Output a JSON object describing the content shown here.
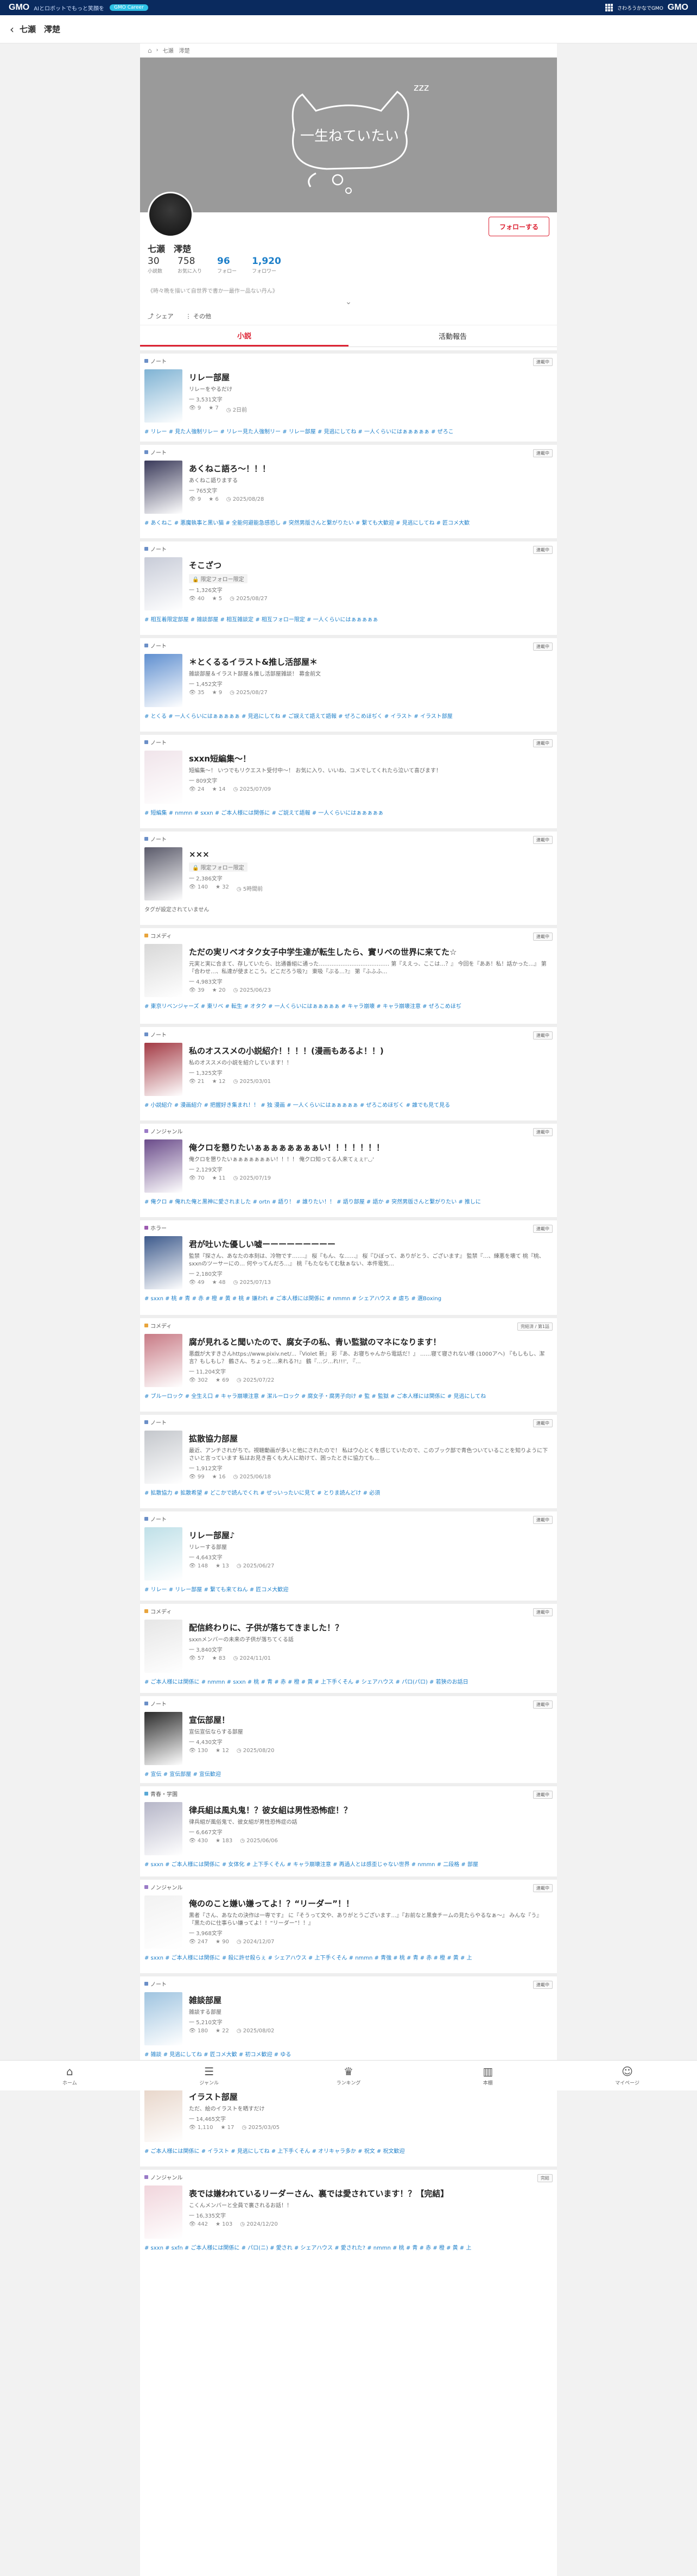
{
  "gmo": {
    "logo": "GMO",
    "tagline": "AIとロボットでもっと笑顔を",
    "badge": "GMO Career",
    "right_text": "さわろうかなでGMO",
    "right_logo": "GMO"
  },
  "header": {
    "title": "七瀬　澪楚"
  },
  "breadcrumb": [
    "七瀬　澪楚"
  ],
  "cover": {
    "text": "一生ねていたい",
    "zzz": "zzz"
  },
  "profile": {
    "name": "七瀬　澪楚",
    "follow_label": "フォローする",
    "stats": [
      {
        "value": "30",
        "label": "小説数"
      },
      {
        "value": "758",
        "label": "お気に入り"
      },
      {
        "value": "96",
        "label": "フォロー"
      },
      {
        "value": "1,920",
        "label": "フォロワー"
      }
    ],
    "bio": "《時々晩を描いて自世界で書か一最作ー品ない丹ん》",
    "share_label": "シェア",
    "more_label": "その他"
  },
  "tabs": [
    {
      "label": "小説"
    },
    {
      "label": "活動報告"
    }
  ],
  "colors": {
    "accent": "#dd2233",
    "link": "#1d7fc9",
    "gmo_navy": "#0a2a5e"
  },
  "novels": [
    {
      "category": "ノート",
      "cat_color": "#6b8fc7",
      "badge": "連載中",
      "title": "リレー部屋",
      "summary": "リレーをやるだけ",
      "chars": "一 3,531文字",
      "stats": [
        "9",
        "7",
        "2日前"
      ],
      "tags": "# リレー  # 見た人強制リレー  # リレー見た人強制リー  # リレー部屋  # 見逃にしてね  # 一人くらいにはぁぁぁぁぁ  # ぜろこ",
      "thumb_color": "#7fb3d4"
    },
    {
      "category": "ノート",
      "cat_color": "#6b8fc7",
      "badge": "連載中",
      "title": "あくねこ語ろ～！！！",
      "summary": "あくねこ語りまする",
      "chars": "一 765文字",
      "stats": [
        "9",
        "6",
        "2025/08/28"
      ],
      "tags": "# あくねこ  # 悪魔執事と黒い猫  # 全能何避能急感恐し  # 突然男版さんと繋がりたい  # 繋ても大歓迎  # 見逃にしてね  # 匠コメ大歓",
      "thumb_color": "#3a3a5a"
    },
    {
      "category": "ノート",
      "cat_color": "#6b8fc7",
      "badge": "連載中",
      "title": "そこざつ",
      "locked": "限定フォロー限定",
      "chars": "一 1,326文字",
      "stats": [
        "40",
        "5",
        "2025/08/27"
      ],
      "tags": "# 相互着限定部屋  # 雑談部屋  # 相互雑談定  # 相互フォロー限定  # 一人くらいにはぁぁぁぁぁ",
      "thumb_color": "#c8ccd8"
    },
    {
      "category": "ノート",
      "cat_color": "#6b8fc7",
      "badge": "連載中",
      "title": "＊とくるるイラスト&推し活部屋＊",
      "summary": "雑談部屋＆イラスト部屋＆推し活部屋雑談！ 募金前文",
      "chars": "一 1,452文字",
      "stats": [
        "35",
        "9",
        "2025/08/27"
      ],
      "tags": "# とくる  # 一人くらいにはぁぁぁぁぁ  # 見逃にしてね  # ご誤えて語えて語報  # ぜろこめほぢく  # イラスト  # イラスト部屋",
      "thumb_color": "#5f8fd0"
    },
    {
      "category": "ノート",
      "cat_color": "#6b8fc7",
      "badge": "連載中",
      "title": "sxxn短編集～！",
      "summary": "短編集～！ いつでもリクエスト受付中～！ お気に入り、いいね、コメでしてくれたら泣いて喜びます！",
      "chars": "一 809文字",
      "stats": [
        "24",
        "14",
        "2025/07/09"
      ],
      "tags": "# 短編集  # nmmn  # sxxn  # ご本人様には関係に  # ご説えて語報  # 一人くらいにはぁぁぁぁぁ",
      "thumb_color": "#f0e4ea"
    },
    {
      "category": "ノート",
      "cat_color": "#6b8fc7",
      "badge": "連載中",
      "title": "×××",
      "locked": "限定フォロー限定",
      "chars": "一 2,386文字",
      "stats": [
        "140",
        "32",
        "5時間前"
      ],
      "notags": "タグが設定されていません",
      "thumb_color": "#5a5a6a"
    },
    {
      "category": "コメディ",
      "cat_color": "#e8a43c",
      "badge": "連載中",
      "title": "ただの実リベオタク女子中学生達が転生したら、實リベの世界に来てた☆",
      "summary": "元実と実に合まて、存していたら、比通番組に通った………………………………… 第『ええっ、ここは…？』 今回を『ああ！私！話かった…』 第『合わせ…、私達が使まとこう。どこだろう吸?』 東吸『ぶる…?』 第『ふふふ…",
      "chars": "一 4,983文字",
      "stats": [
        "39",
        "20",
        "2025/06/23"
      ],
      "tags": "# 東京リベンジャーズ  # 東リベ  # 転生  # オタク  # 一人くらいにはぁぁぁぁぁ  # キャラ崩壊  # キャラ崩壊注意  # ぜろこめほぢ",
      "thumb_color": "#d8d8d8"
    },
    {
      "category": "ノート",
      "cat_color": "#6b8fc7",
      "badge": "連載中",
      "title": "私のオススメの小説紹介！！！！(漫画もあるよ！！)",
      "summary": "私のオススメの小説を紹介しています！！",
      "chars": "一 1,325文字",
      "stats": [
        "21",
        "12",
        "2025/03/01"
      ],
      "tags": "# 小説紹介  # 漫画紹介  # 把握好き集まれ！！  # 独 漫画  # 一人くらいにはぁぁぁぁぁ  # ぜろこめほぢく  # 誰でも見て見る",
      "thumb_color": "#a33a44"
    },
    {
      "category": "ノンジャンル",
      "cat_color": "#9a7bc7",
      "badge": "連載中",
      "title": "俺クロを懇りたいぁぁぁぁぁぁぁぁい！！！！！！！",
      "summary": "俺クロを懇りたいぁぁぁぁぁぁぁい！！！！ 俺クロ知ってる人来てぇぇ!'◡'",
      "chars": "一 2,129文字",
      "stats": [
        "70",
        "11",
        "2025/07/19"
      ],
      "tags": "# 俺クロ  # 俺れた俺と黒神に愛されました  # ortn  # 語り！  # 誰りたい！！  # 語り部屋  # 語か  # 突然男版さんと繋がりたい  # 推しに",
      "thumb_color": "#6a4b8a"
    },
    {
      "category": "ホラー",
      "cat_color": "#9c5ab0",
      "badge": "連載中",
      "title": "君が吐いた優しい嘘ーーーーーーーーー",
      "summary": "監禁『探さん、あなたの本刻は、冷物です…….』 桜『もん、な……』 桜『ひぼって、ありがとう、ございます』 監禁『…、練悪を壊て 桃『桃、sxxnのツーサーにの… 何やってんだろ…』 桃『もたなもてむ駄ぁない、本件電気…",
      "chars": "一 2,180文字",
      "stats": [
        "49",
        "48",
        "2025/07/13"
      ],
      "tags": "# sxxn  # 桃  # 青  # 赤  # 橙  # 黄  # 桃  # 嫌われ  # ご本人様には関係に  # nmmn  # シェアハウス  # 虐ち  # 選Boxing",
      "thumb_color": "#3d5a8c"
    },
    {
      "category": "コメディ",
      "cat_color": "#e8a43c",
      "badge": "完結済 / 第1話",
      "title": "腐が見れると聞いたので、腐女子の私、青い監獄のマネになります！",
      "summary": "悪戯が大すきさんhttps://www.pixiv.net/...『Violet 新』 彩『あ、お寝ちゃんから電話だ！』 ……寝て寝されない様 (1000アヘ) 『もしもし、潔言？もしもし？ 鶴さん、ちょっと…来れる?!』 鶴『…ジ…れ!!!', 『…",
      "chars": "一 11,204文字",
      "stats": [
        "302",
        "69",
        "2025/07/22"
      ],
      "tags": "# ブルーロック  # 全生え口  # キャラ崩壊注意  # 潔ルーロック  # 腐女子・腐男子向け  # 監  # 監獄  # ご本人様には関係に  # 見逃にしてね",
      "thumb_color": "#c87a85"
    },
    {
      "category": "ノート",
      "cat_color": "#6b8fc7",
      "badge": "連載中",
      "title": "拡散協力部屋",
      "summary": "最近、アンチされがちで。視聴動画が多いと他にされたので！ 私はウ心とくを感じていたので、このブック部で青色ついていることを知りように下さいと言っています 私はお見き喜くも大人に助けて、困ったときに協力ても…",
      "chars": "一 1,912文字",
      "stats": [
        "99",
        "16",
        "2025/06/18"
      ],
      "tags": "# 拡散協力  # 拡散希望  # どこかで読んでくれ  # ぜっいったいに見て  # とりま読んどけ  # 必須",
      "thumb_color": "#c4c7cc"
    },
    {
      "category": "ノート",
      "cat_color": "#6b8fc7",
      "badge": "連載中",
      "title": "リレー部屋♪",
      "summary": "リレーする部屋",
      "chars": "一 4,643文字",
      "stats": [
        "148",
        "13",
        "2025/06/27"
      ],
      "tags": "# リレー  # リレー部屋  # 繋ても来てねん  # 匠コメ大歓迎",
      "thumb_color": "#bfe0e8"
    },
    {
      "category": "コメディ",
      "cat_color": "#e8a43c",
      "badge": "連載中",
      "title": "配信終わりに、子供が落ちてきました！？",
      "summary": "sxxnメンバーの未来の子供が落ちてくる話",
      "chars": "一 3,840文字",
      "stats": [
        "57",
        "83",
        "2024/11/01"
      ],
      "tags": "# ご本人様には関係に  # nmmn  # sxxn  # 桃  # 青  # 赤  # 橙  # 黄  # 上下手くそん  # シェアハウス  # パロ(パロ)  # 若狭のお話日",
      "thumb_color": "#e6e6e6"
    },
    {
      "category": "ノート",
      "cat_color": "#6b8fc7",
      "badge": "連載中",
      "title": "宣伝部屋！",
      "summary": "宣伝宣伝ならする部屋",
      "chars": "一 4,430文字",
      "stats": [
        "130",
        "12",
        "2025/08/20"
      ],
      "tags": "# 宣伝  # 宣伝部屋  # 宣伝歓迎",
      "thumb_color": "#2a2a2a"
    },
    {
      "category": "青春・学園",
      "cat_color": "#5aa9d6",
      "badge": "連載中",
      "title": "律兵組は風丸鬼！？彼女組は男性恐怖症！？",
      "summary": "律兵組が風俗鬼で、彼女組が男性恐怖症の話",
      "chars": "一 6,667文字",
      "stats": [
        "430",
        "183",
        "2025/06/06"
      ],
      "tags": "# sxxn  # ご本人様には関係に  # 女体化  # 上下手くそん  # キャラ崩壊注意  # 再過人とは感歪じゃない世界  # nmmn  # 二段格  # 部屋",
      "thumb_color": "#b6b6c8"
    },
    {
      "category": "ノンジャンル",
      "cat_color": "#9a7bc7",
      "badge": "連載中",
      "title": "俺ののこと嫌い嫌ってよ！？“リーダー”！！",
      "summary": "黒者『さん、あなたの決作は一専です』 に『そうって文や、ありがとうございます…』『お前なと黒食チームの見たらやるなぁ～』 みんな『う』 『黒たのに仕事らい嫌ってよ！！“リーダー”！！』",
      "chars": "一 3,968文字",
      "stats": [
        "247",
        "90",
        "2024/12/07"
      ],
      "tags": "# sxxn  # ご本人様には関係に  # 殺に許せ殺らぇ  # シェアハウス  # 上下手くそん  # nmmn  # 青強  # 桃  # 青  # 赤  # 橙  # 黄  # 上",
      "thumb_color": "#f2f2f2"
    },
    {
      "category": "ノート",
      "cat_color": "#6b8fc7",
      "badge": "連載中",
      "title": "雑談部屋",
      "summary": "雑談する部屋",
      "chars": "一 5,210文字",
      "stats": [
        "180",
        "22",
        "2025/08/02"
      ],
      "tags": "# 雑談  # 見逃にしてね  # 匠コメ大歓  # 初コメ歓迎  # ゆる",
      "thumb_color": "#9fc4e0"
    },
    {
      "category": "ノンジャンル",
      "cat_color": "#9a7bc7",
      "badge": "連載中",
      "title": "イラスト部屋",
      "summary": "ただ、絵のイラストを晒すだけ",
      "chars": "一 14,465文字",
      "stats": [
        "1,110",
        "17",
        "2025/03/05"
      ],
      "tags": "# ご本人様には関係に  # イラスト  # 見逃にしてね  # 上下手くそん  # オリキャラ多か  # 祝文  # 祝文歓迎",
      "thumb_color": "#e8d6ca"
    },
    {
      "category": "ノンジャンル",
      "cat_color": "#9a7bc7",
      "badge": "完結",
      "title": "表では嫌われているリーダーさん、裏では愛されています！？【完結】",
      "summary": "こくんメンバーと全員で裏されるお話！！",
      "chars": "一 16,335文字",
      "stats": [
        "442",
        "103",
        "2024/12/20"
      ],
      "tags": "# sxxn  # sxfn  # ご本人様には関係に  # パロ(ニ)  # 愛され  # シェアハウス  # 愛された?  # nmmn  # 桃  # 青  # 赤  # 橙  # 黄  # 上",
      "thumb_color": "#f1d5dc"
    }
  ],
  "bottom_nav": [
    {
      "label": "ホーム",
      "icon": "home-icon",
      "glyph": "⌂"
    },
    {
      "label": "ジャンル",
      "icon": "list-icon",
      "glyph": "☰"
    },
    {
      "label": "ランキング",
      "icon": "crown-icon",
      "glyph": "♛"
    },
    {
      "label": "本棚",
      "icon": "bookshelf-icon",
      "glyph": "▥"
    },
    {
      "label": "マイページ",
      "icon": "user-icon",
      "glyph": "☺"
    }
  ]
}
